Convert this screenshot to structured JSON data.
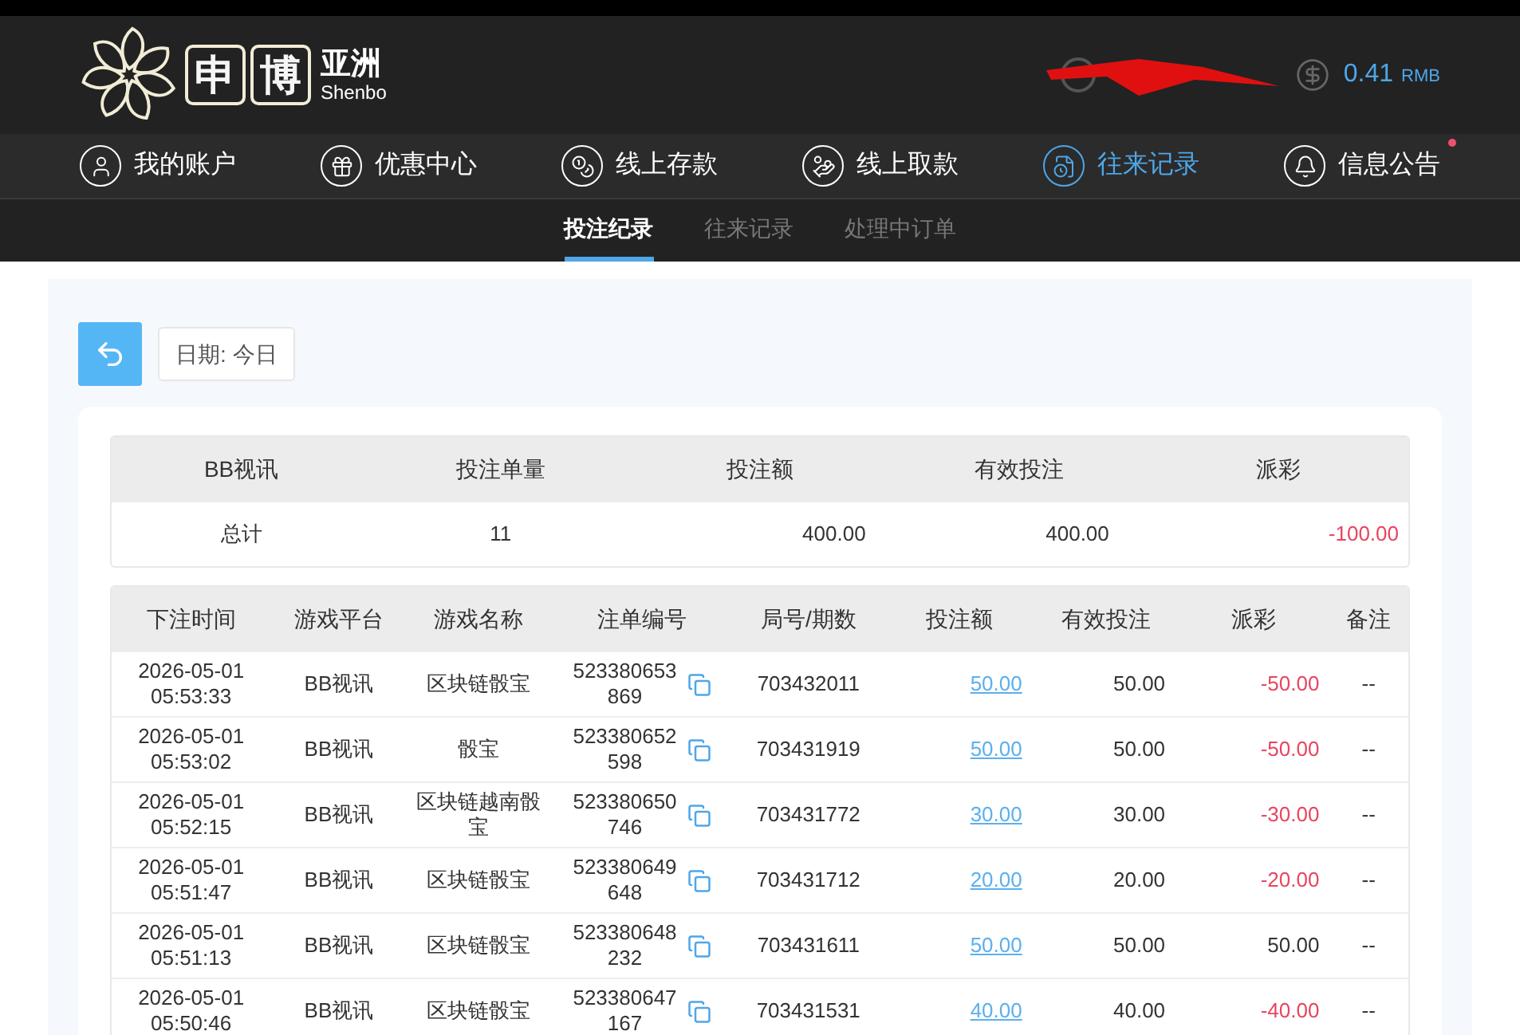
{
  "logo": {
    "boxed": [
      "申",
      "博"
    ],
    "region": "亚洲",
    "latin": "Shenbo"
  },
  "account": {
    "balance": "0.41",
    "currency": "RMB"
  },
  "nav": [
    {
      "label": "我的账户",
      "kind": "user",
      "selected": false,
      "unread": false
    },
    {
      "label": "优惠中心",
      "kind": "gift",
      "selected": false,
      "unread": false
    },
    {
      "label": "线上存款",
      "kind": "deposit",
      "selected": false,
      "unread": false
    },
    {
      "label": "线上取款",
      "kind": "withdraw",
      "selected": false,
      "unread": false
    },
    {
      "label": "往来记录",
      "kind": "record",
      "selected": true,
      "unread": false
    },
    {
      "label": "信息公告",
      "kind": "bell",
      "selected": false,
      "unread": true
    }
  ],
  "subtabs": [
    {
      "label": "投注纪录",
      "selected": true
    },
    {
      "label": "往来记录",
      "selected": false
    },
    {
      "label": "处理中订单",
      "selected": false
    }
  ],
  "date_filter": "日期: 今日",
  "summary": {
    "columns": [
      "BB视讯",
      "投注单量",
      "投注额",
      "有效投注",
      "派彩"
    ],
    "row": {
      "label": "总计",
      "count": "11",
      "bet": "400.00",
      "valid": "400.00",
      "payout": "-100.00",
      "payout_negative": true
    }
  },
  "table": {
    "columns": [
      "下注时间",
      "游戏平台",
      "游戏名称",
      "注单编号",
      "局号/期数",
      "投注额",
      "有效投注",
      "派彩",
      "备注"
    ],
    "rows": [
      {
        "date": "2026-05-01",
        "time": "05:53:33",
        "platform": "BB视讯",
        "game": "区块链骰宝",
        "order": "523380653869",
        "round": "703432011",
        "bet": "50.00",
        "valid": "50.00",
        "payout": "-50.00",
        "payout_negative": true,
        "note": "--"
      },
      {
        "date": "2026-05-01",
        "time": "05:53:02",
        "platform": "BB视讯",
        "game": "骰宝",
        "order": "523380652598",
        "round": "703431919",
        "bet": "50.00",
        "valid": "50.00",
        "payout": "-50.00",
        "payout_negative": true,
        "note": "--"
      },
      {
        "date": "2026-05-01",
        "time": "05:52:15",
        "platform": "BB视讯",
        "game": "区块链越南骰宝",
        "order": "523380650746",
        "round": "703431772",
        "bet": "30.00",
        "valid": "30.00",
        "payout": "-30.00",
        "payout_negative": true,
        "note": "--"
      },
      {
        "date": "2026-05-01",
        "time": "05:51:47",
        "platform": "BB视讯",
        "game": "区块链骰宝",
        "order": "523380649648",
        "round": "703431712",
        "bet": "20.00",
        "valid": "20.00",
        "payout": "-20.00",
        "payout_negative": true,
        "note": "--"
      },
      {
        "date": "2026-05-01",
        "time": "05:51:13",
        "platform": "BB视讯",
        "game": "区块链骰宝",
        "order": "523380648232",
        "round": "703431611",
        "bet": "50.00",
        "valid": "50.00",
        "payout": "50.00",
        "payout_negative": false,
        "note": "--"
      },
      {
        "date": "2026-05-01",
        "time": "05:50:46",
        "platform": "BB视讯",
        "game": "区块链骰宝",
        "order": "523380647167",
        "round": "703431531",
        "bet": "40.00",
        "valid": "40.00",
        "payout": "-40.00",
        "payout_negative": true,
        "note": "--"
      }
    ]
  }
}
